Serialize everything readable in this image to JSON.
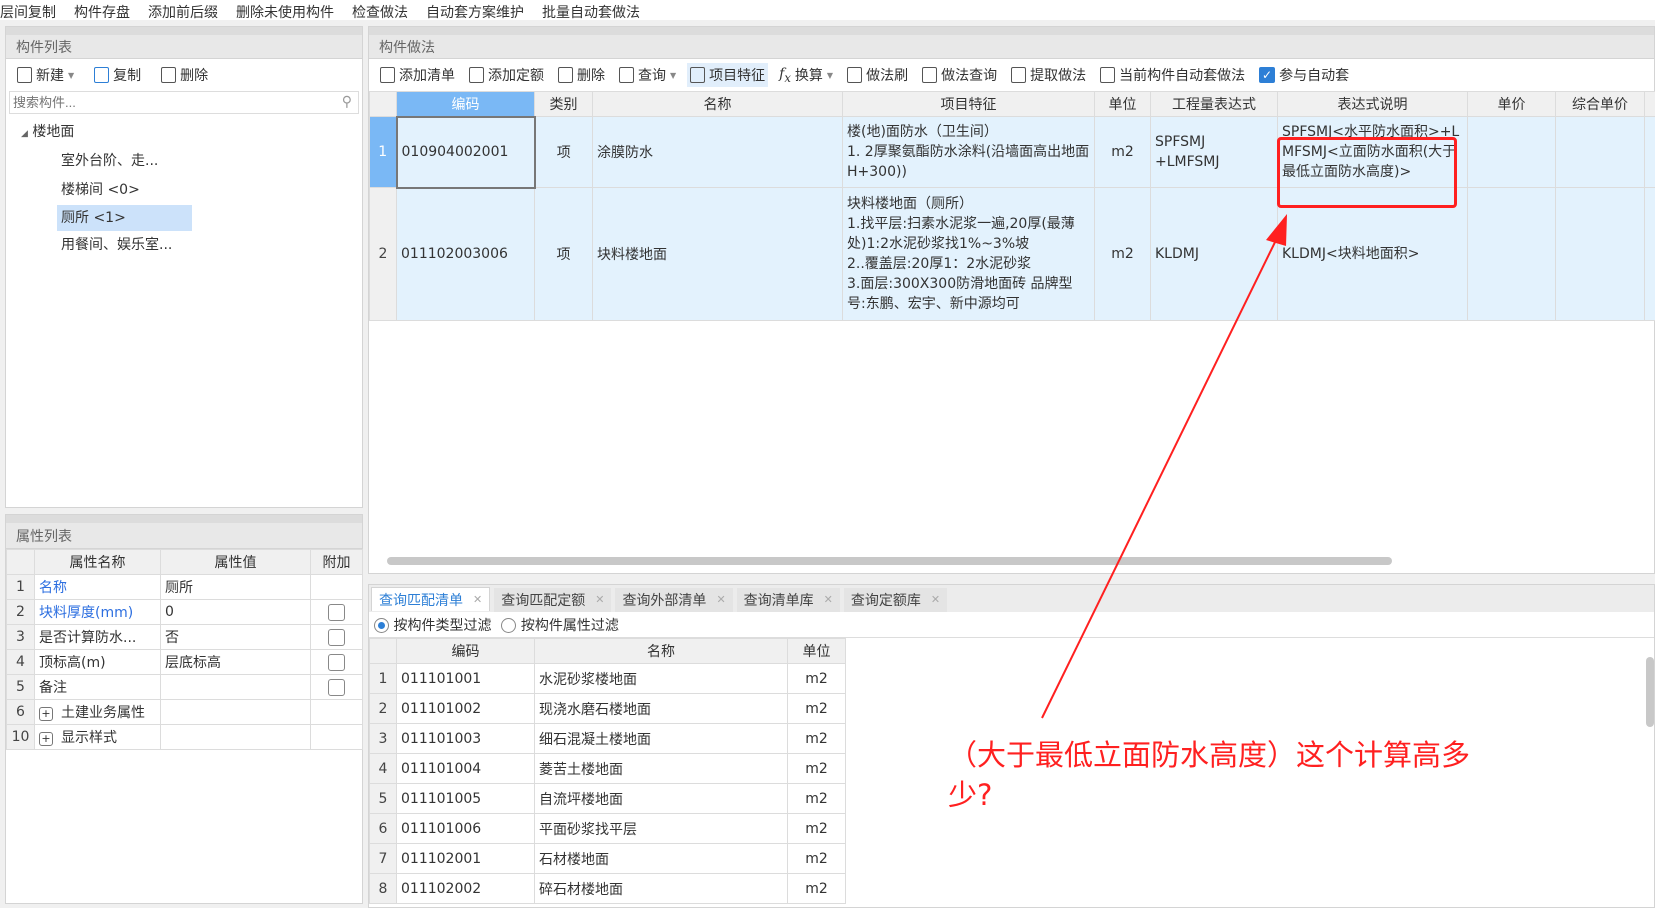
{
  "top_toolbar": [
    "层间复制",
    "构件存盘",
    "添加前后缀",
    "删除未使用构件",
    "检查做法",
    "自动套方案维护",
    "批量自动套做法"
  ],
  "left": {
    "title": "构件列表",
    "toolbar": {
      "new": "新建",
      "copy": "复制",
      "delete": "删除"
    },
    "search_placeholder": "搜索构件...",
    "tree": {
      "root": "楼地面",
      "items": [
        "室外台阶、走...",
        "楼梯间 <0>",
        "厕所 <1>",
        "用餐间、娱乐室..."
      ],
      "selected": 2
    }
  },
  "props": {
    "title": "属性列表",
    "headers": [
      "属性名称",
      "属性值",
      "附加"
    ],
    "rows": [
      {
        "n": "1",
        "name": "名称",
        "value": "厕所"
      },
      {
        "n": "2",
        "name": "块料厚度(mm)",
        "value": "0"
      },
      {
        "n": "3",
        "name": "是否计算防水...",
        "value": "否"
      },
      {
        "n": "4",
        "name": "顶标高(m)",
        "value": "层底标高"
      },
      {
        "n": "5",
        "name": "备注",
        "value": ""
      },
      {
        "n": "6",
        "name": "土建业务属性",
        "value": ""
      },
      {
        "n": "10",
        "name": "显示样式",
        "value": ""
      }
    ]
  },
  "right": {
    "title": "构件做法",
    "toolbar": [
      "添加清单",
      "添加定额",
      "删除",
      "查询",
      "项目特征",
      "换算",
      "做法刷",
      "做法查询",
      "提取做法",
      "当前构件自动套做法"
    ],
    "auto_checkbox": "参与自动套",
    "headers": [
      "编码",
      "类别",
      "名称",
      "项目特征",
      "单位",
      "工程量表达式",
      "表达式说明",
      "单价",
      "综合单价"
    ],
    "rows": [
      {
        "n": "1",
        "code": "010904002001",
        "type": "项",
        "name": "涂膜防水",
        "feature": [
          "楼(地)面防水（卫生间）",
          "1. 2厚聚氨酯防水涂料(沿墙面高出地面H+300))"
        ],
        "unit": "m2",
        "expr": [
          "SPFSMJ",
          "+LMFSMJ"
        ],
        "desc": "SPFSMJ<水平防水面积>+LMFSMJ<立面防水面积(大于最低立面防水高度)>"
      },
      {
        "n": "2",
        "code": "011102003006",
        "type": "项",
        "name": "块料楼地面",
        "feature": [
          "块料楼地面（厕所）",
          "1.找平层:扫素水泥浆一遍,20厚(最薄处)1:2水泥砂浆找1%~3%坡",
          "2..覆盖层:20厚1：2水泥砂浆",
          "3.面层:300X300防滑地面砖 品牌型号:东鹏、宏宇、新中源均可"
        ],
        "unit": "m2",
        "expr": [
          "KLDMJ"
        ],
        "desc": "KLDMJ<块料地面积>"
      }
    ]
  },
  "bottom": {
    "tabs": [
      "查询匹配清单",
      "查询匹配定额",
      "查询外部清单",
      "查询清单库",
      "查询定额库"
    ],
    "filters": [
      "按构件类型过滤",
      "按构件属性过滤"
    ],
    "headers": [
      "编码",
      "名称",
      "单位"
    ],
    "rows": [
      [
        "1",
        "011101001",
        "水泥砂浆楼地面",
        "m2"
      ],
      [
        "2",
        "011101002",
        "现浇水磨石楼地面",
        "m2"
      ],
      [
        "3",
        "011101003",
        "细石混凝土楼地面",
        "m2"
      ],
      [
        "4",
        "011101004",
        "菱苦土楼地面",
        "m2"
      ],
      [
        "5",
        "011101005",
        "自流坪楼地面",
        "m2"
      ],
      [
        "6",
        "011101006",
        "平面砂浆找平层",
        "m2"
      ],
      [
        "7",
        "011102001",
        "石材楼地面",
        "m2"
      ],
      [
        "8",
        "011102002",
        "碎石材楼地面",
        "m2"
      ]
    ]
  },
  "annotation": {
    "text": "（大于最低立面防水高度）这个计算高多少?",
    "color": "#ff2020"
  }
}
